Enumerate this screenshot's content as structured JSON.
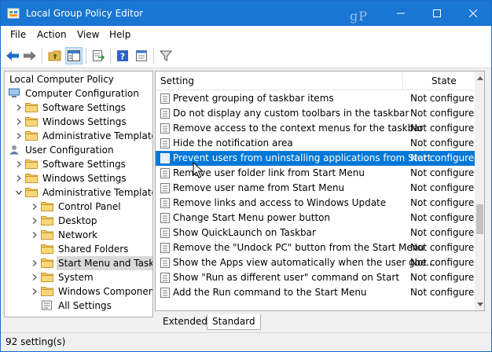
{
  "window": {
    "title": "Local Group Policy Editor",
    "accent_color": "#1976d2",
    "controls": [
      "minimize-icon",
      "maximize-icon",
      "close-icon"
    ]
  },
  "menu": {
    "items": [
      "File",
      "Action",
      "View",
      "Help"
    ]
  },
  "toolbar": {
    "icons": [
      "back-arrow-icon",
      "forward-arrow-icon",
      "up-folder-icon",
      "show-hide-tree-icon",
      "export-list-icon",
      "help-icon",
      "properties-icon",
      "filter-icon"
    ]
  },
  "tree": {
    "items": [
      {
        "label": "Local Computer Policy",
        "level": 0,
        "expander": "none",
        "icon": "none"
      },
      {
        "label": "Computer Configuration",
        "level": 0,
        "expander": "none",
        "icon": "computer-icon"
      },
      {
        "label": "Software Settings",
        "level": 1,
        "expander": "collapsed",
        "icon": "folder-icon"
      },
      {
        "label": "Windows Settings",
        "level": 1,
        "expander": "collapsed",
        "icon": "folder-icon"
      },
      {
        "label": "Administrative Templates",
        "level": 1,
        "expander": "collapsed",
        "icon": "folder-icon"
      },
      {
        "label": "User Configuration",
        "level": 0,
        "expander": "none",
        "icon": "user-icon"
      },
      {
        "label": "Software Settings",
        "level": 1,
        "expander": "collapsed",
        "icon": "folder-icon"
      },
      {
        "label": "Windows Settings",
        "level": 1,
        "expander": "collapsed",
        "icon": "folder-icon"
      },
      {
        "label": "Administrative Templates",
        "level": 1,
        "expander": "expanded",
        "icon": "folder-icon"
      },
      {
        "label": "Control Panel",
        "level": 2,
        "expander": "collapsed",
        "icon": "folder-icon"
      },
      {
        "label": "Desktop",
        "level": 2,
        "expander": "collapsed",
        "icon": "folder-icon"
      },
      {
        "label": "Network",
        "level": 2,
        "expander": "collapsed",
        "icon": "folder-icon"
      },
      {
        "label": "Shared Folders",
        "level": 2,
        "expander": "none",
        "icon": "folder-icon"
      },
      {
        "label": "Start Menu and Taskbar",
        "level": 2,
        "expander": "collapsed",
        "icon": "folder-icon",
        "selected": true
      },
      {
        "label": "System",
        "level": 2,
        "expander": "collapsed",
        "icon": "folder-icon"
      },
      {
        "label": "Windows Components",
        "level": 2,
        "expander": "collapsed",
        "icon": "folder-icon"
      },
      {
        "label": "All Settings",
        "level": 2,
        "expander": "none",
        "icon": "all-settings-icon"
      }
    ]
  },
  "list": {
    "columns": {
      "setting": "Setting",
      "state": "State"
    },
    "rows": [
      {
        "name": "Prevent grouping of taskbar items",
        "state": "Not configured"
      },
      {
        "name": "Do not display any custom toolbars in the taskbar",
        "state": "Not configured"
      },
      {
        "name": "Remove access to the context menus for the taskbar",
        "state": "Not configured"
      },
      {
        "name": "Hide the notification area",
        "state": "Not configured"
      },
      {
        "name": "Prevent users from uninstalling applications from Start",
        "state": "Not configured",
        "selected": true
      },
      {
        "name": "Remove user folder link from Start Menu",
        "state": "Not configured"
      },
      {
        "name": "Remove user name from Start Menu",
        "state": "Not configured"
      },
      {
        "name": "Remove links and access to Windows Update",
        "state": "Not configured"
      },
      {
        "name": "Change Start Menu power button",
        "state": "Not configured"
      },
      {
        "name": "Show QuickLaunch on Taskbar",
        "state": "Not configured"
      },
      {
        "name": "Remove the \"Undock PC\" button from the Start Menu",
        "state": "Not configured"
      },
      {
        "name": "Show the Apps view automatically when the user goe...",
        "state": "Not configured"
      },
      {
        "name": "Show \"Run as different user\" command on Start",
        "state": "Not configured"
      },
      {
        "name": "Add the Run command to the Start Menu",
        "state": "Not configured"
      }
    ],
    "selection_color": "#0078d7"
  },
  "tabs": [
    {
      "label": "Extended",
      "active": false
    },
    {
      "label": "Standard",
      "active": true
    }
  ],
  "status": {
    "text": "92 setting(s)"
  },
  "watermark": "gP"
}
